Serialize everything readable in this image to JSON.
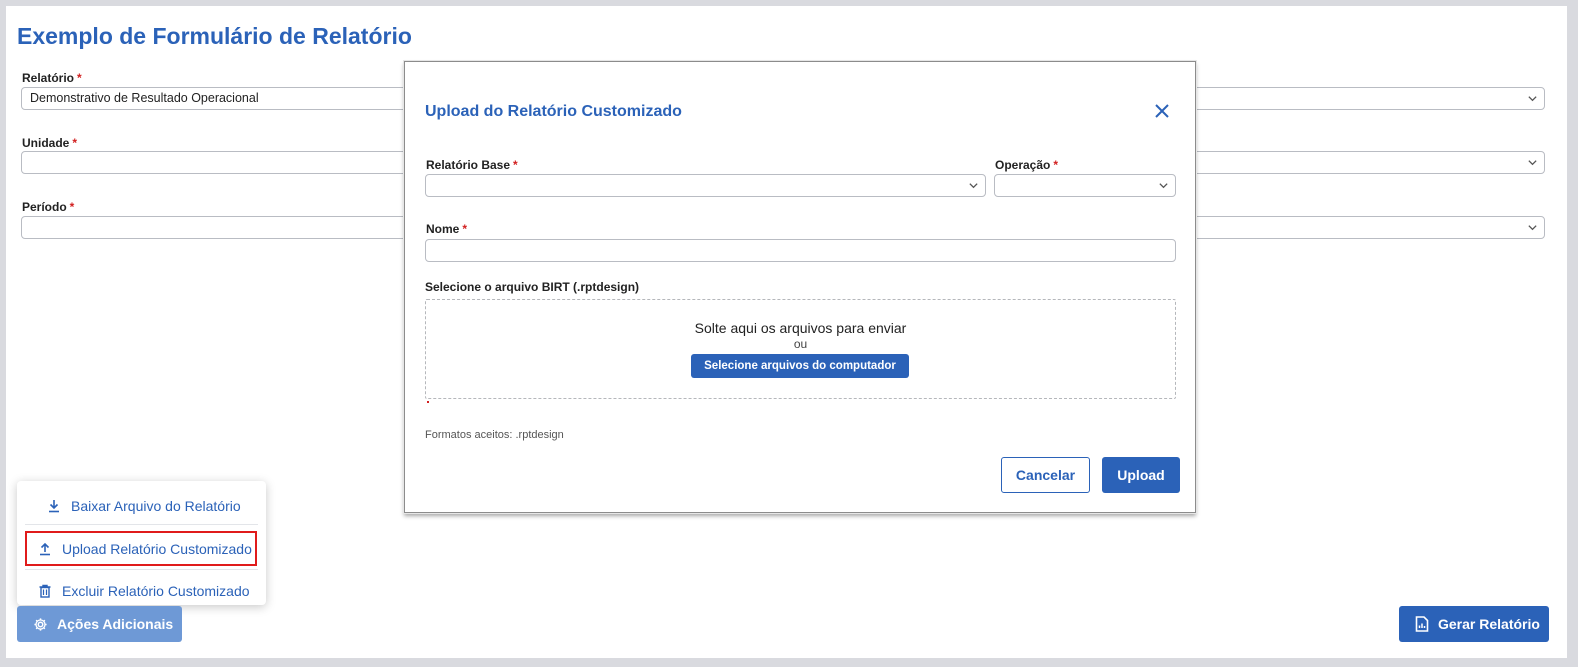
{
  "page": {
    "title": "Exemplo de Formulário de Relatório"
  },
  "form": {
    "relatorio": {
      "label": "Relatório",
      "required_mark": "*",
      "value": "Demonstrativo de Resultado Operacional"
    },
    "unidade": {
      "label": "Unidade",
      "required_mark": "*",
      "value": ""
    },
    "periodo": {
      "label": "Período",
      "required_mark": "*",
      "value": ""
    }
  },
  "menu": {
    "items": [
      {
        "label": "Baixar Arquivo do Relatório",
        "icon": "download-icon"
      },
      {
        "label": "Upload Relatório Customizado",
        "icon": "upload-icon",
        "highlighted": true
      },
      {
        "label": "Excluir Relatório Customizado",
        "icon": "trash-icon"
      }
    ]
  },
  "footer": {
    "acoes_label": "Ações Adicionais",
    "gerar_label": "Gerar Relatório"
  },
  "modal": {
    "title": "Upload do Relatório Customizado",
    "relatorio_base": {
      "label": "Relatório Base",
      "required_mark": "*",
      "value": ""
    },
    "operacao": {
      "label": "Operação",
      "required_mark": "*",
      "value": ""
    },
    "nome": {
      "label": "Nome",
      "required_mark": "*",
      "value": ""
    },
    "file_label": "Selecione o arquivo BIRT (.rptdesign)",
    "dropzone": {
      "text": "Solte aqui os arquivos para enviar",
      "or": "ou",
      "button": "Selecione arquivos do computador"
    },
    "formats": "Formatos aceitos: .rptdesign",
    "cancel_label": "Cancelar",
    "upload_label": "Upload"
  },
  "colors": {
    "primary": "#2b62b8",
    "primary_disabled": "#6e99d6",
    "required": "#d22020",
    "highlight_border": "#e01b1b"
  }
}
